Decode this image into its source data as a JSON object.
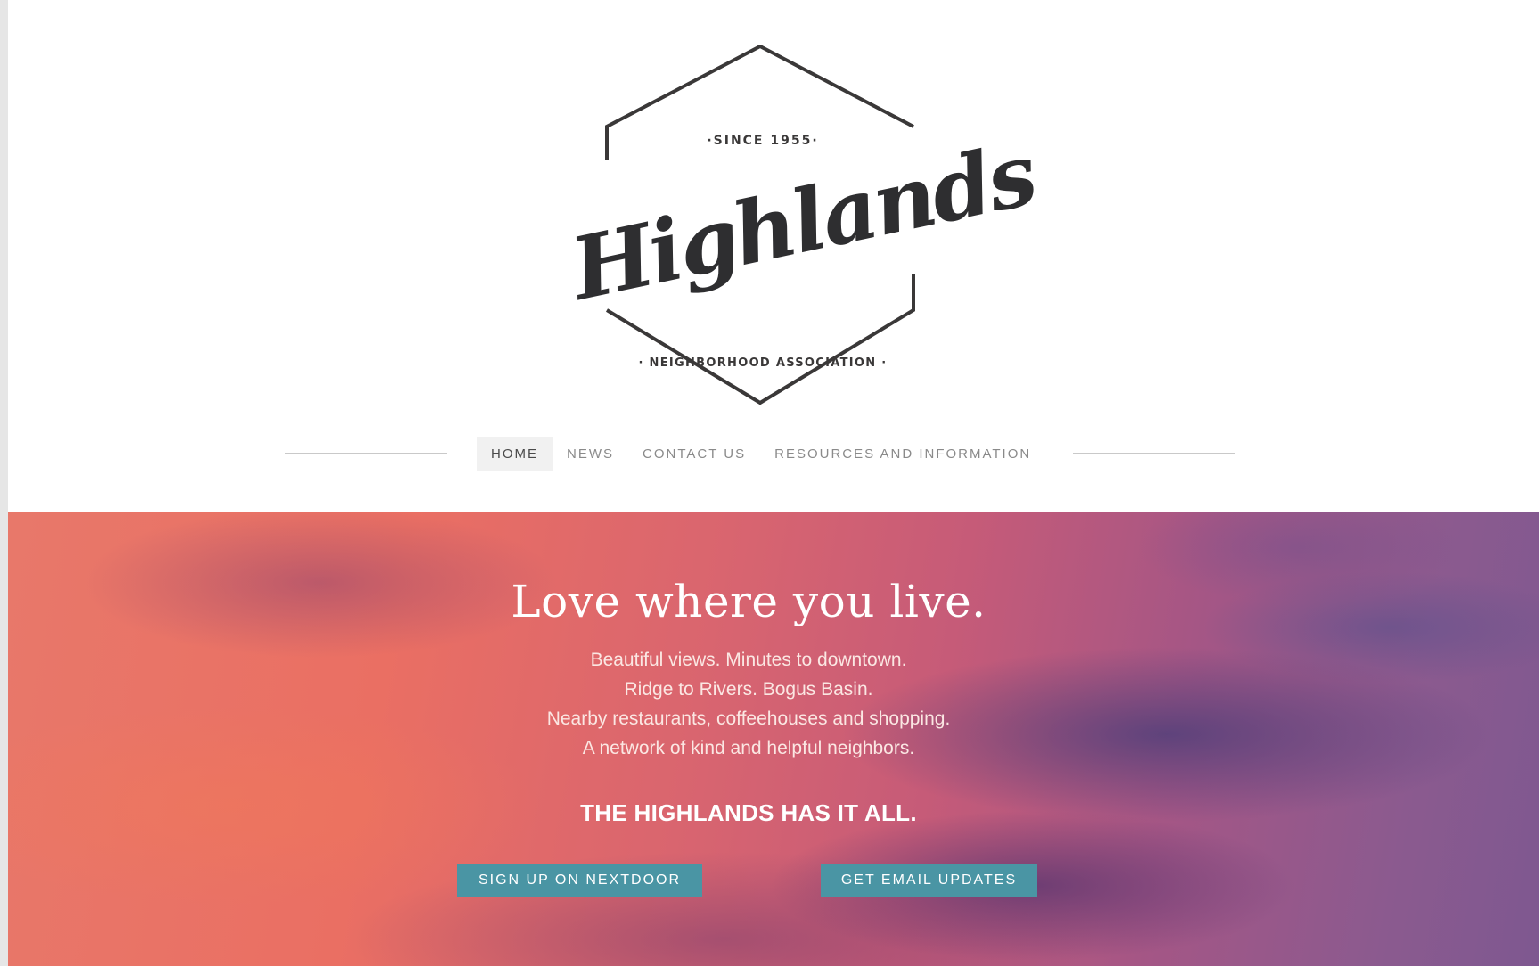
{
  "logo": {
    "since": "·SINCE 1955·",
    "name": "Highlands",
    "subtitle": "· NEIGHBORHOOD ASSOCIATION ·"
  },
  "nav": {
    "items": [
      {
        "label": "HOME",
        "active": true
      },
      {
        "label": "NEWS",
        "active": false
      },
      {
        "label": "CONTACT US",
        "active": false
      },
      {
        "label": "RESOURCES AND INFORMATION",
        "active": false
      }
    ]
  },
  "hero": {
    "title": "Love where you live.",
    "lines": [
      "Beautiful views. Minutes to downtown.",
      "Ridge to Rivers. Bogus Basin.",
      "Nearby restaurants, coffeehouses and shopping.",
      "A network of kind and helpful neighbors."
    ],
    "tagline": "THE HIGHLANDS HAS IT ALL.",
    "buttons": {
      "nextdoor": "SIGN UP ON NEXTDOOR",
      "email": "GET EMAIL UPDATES"
    }
  },
  "colors": {
    "button": "#4a95a4",
    "nav_active_bg": "#f1f1f1",
    "logo_ink": "#3a3838"
  }
}
